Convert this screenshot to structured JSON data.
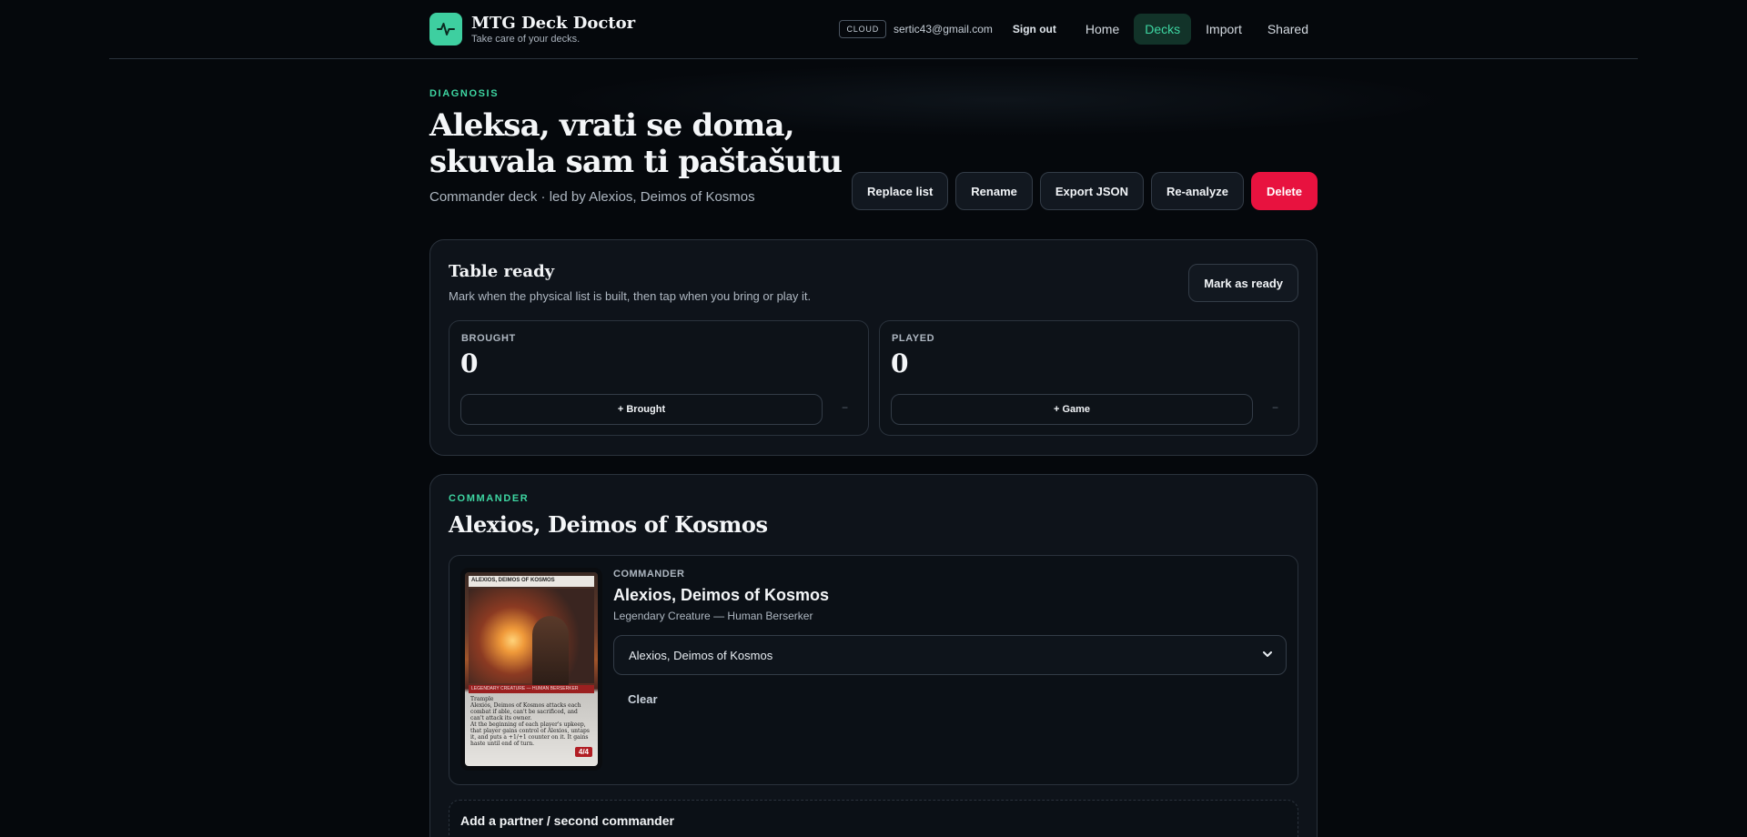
{
  "brand": {
    "title": "MTG Deck Doctor",
    "subtitle": "Take care of your decks."
  },
  "nav": {
    "badge": "CLOUD",
    "email": "sertic43@gmail.com",
    "sign_out": "Sign out",
    "links": [
      "Home",
      "Decks",
      "Import",
      "Shared"
    ],
    "active": "Decks"
  },
  "page": {
    "eyebrow": "DIAGNOSIS",
    "title": "Aleksa, vrati se doma, skuvala sam ti paštašutu",
    "subtitle": "Commander deck · led by Alexios, Deimos of Kosmos"
  },
  "actions": {
    "replace": "Replace list",
    "rename": "Rename",
    "export": "Export JSON",
    "reanalyze": "Re-analyze",
    "delete": "Delete"
  },
  "table_ready": {
    "title": "Table ready",
    "subtitle": "Mark when the physical list is built, then tap when you bring or play it.",
    "mark_button": "Mark as ready",
    "brought": {
      "label": "BROUGHT",
      "value": "0",
      "button": "+ Brought",
      "minus": "−"
    },
    "played": {
      "label": "PLAYED",
      "value": "0",
      "button": "+ Game",
      "minus": "−"
    }
  },
  "commander": {
    "eyebrow": "COMMANDER",
    "heading": "Alexios, Deimos of Kosmos",
    "card_label": "COMMANDER",
    "card_name": "Alexios, Deimos of Kosmos",
    "card_type": "Legendary Creature — Human Berserker",
    "select_value": "Alexios, Deimos of Kosmos",
    "clear": "Clear",
    "card_image": {
      "name_bar": "ALEXIOS, DEIMOS OF KOSMOS",
      "type_bar": "LEGENDARY CREATURE — HUMAN BERSERKER",
      "text_1": "Trample",
      "text_2": "Alexios, Deimos of Kosmos attacks each combat if able, can't be sacrificed, and can't attack its owner.",
      "text_3": "At the beginning of each player's upkeep, that player gains control of Alexios, untaps it, and puts a +1/+1 counter on it. It gains haste until end of turn.",
      "pt": "4/4"
    }
  },
  "partner": {
    "title": "Add a partner / second commander"
  },
  "colors": {
    "accent": "#3ecfa0",
    "danger": "#e8123f",
    "background": "#05080c"
  },
  "icons": {
    "logo": "heartbeat-icon",
    "select": "chevron-down-icon"
  }
}
